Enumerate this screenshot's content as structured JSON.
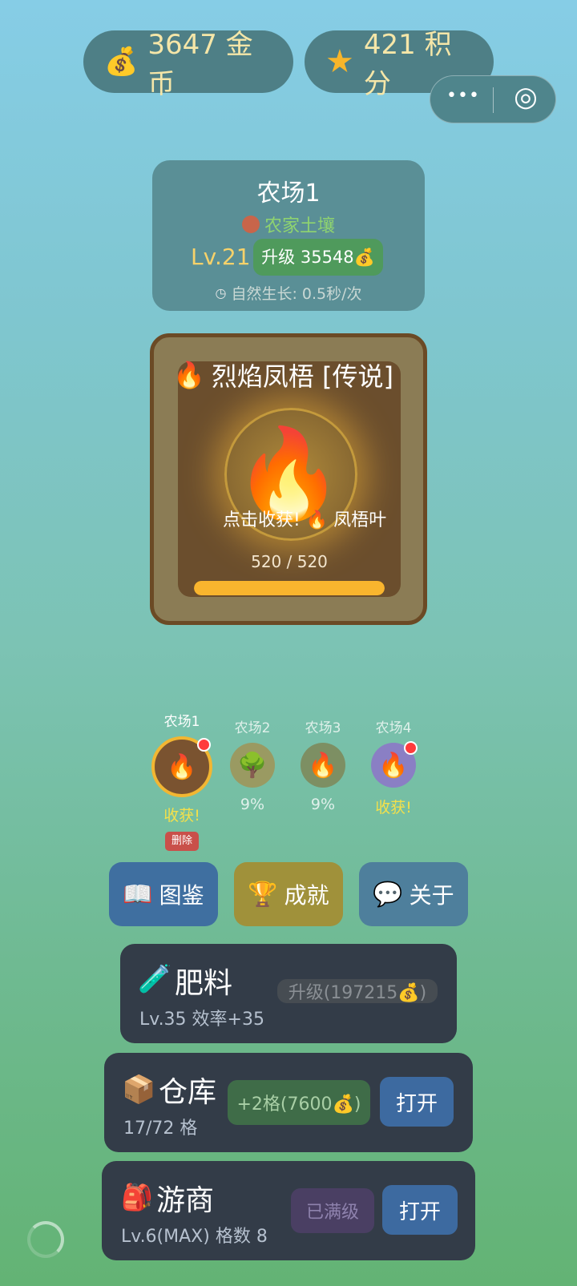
{
  "top": {
    "coins": "3647 金币",
    "points": "421 积分",
    "coin_icon": "💰",
    "star_icon": "★"
  },
  "capsule": {
    "more_icon": "•••",
    "close_icon": "◎"
  },
  "farm_card": {
    "title": "农场1",
    "soil": "农家土壤",
    "level": "Lv.21",
    "upgrade": "升级 35548💰",
    "growth": "自然生长: 0.5秒/次"
  },
  "plant": {
    "name": "烈焰凤梧 [传说]",
    "harvest_text": "点击收获! 🔥 凤梧叶",
    "progress_text": "520 / 520",
    "progress": 1.0
  },
  "farms": [
    {
      "label": "农场1",
      "icon": "🔥",
      "status": "收获!",
      "delete": "删除"
    },
    {
      "label": "农场2",
      "icon": "🌳",
      "status": "9%"
    },
    {
      "label": "农场3",
      "icon": "🔥",
      "status": "9%"
    },
    {
      "label": "农场4",
      "icon": "🔥",
      "status": "收获!"
    }
  ],
  "nav": {
    "encyclopedia": "图鉴",
    "achievements": "成就",
    "about": "关于"
  },
  "fertilizer": {
    "title": "肥料",
    "sub": "Lv.35 效率+35",
    "upgrade": "升级(197215💰)"
  },
  "warehouse": {
    "title": "仓库",
    "sub": "17/72 格",
    "expand": "+2格(7600💰)",
    "open": "打开"
  },
  "merchant": {
    "title": "游商",
    "sub": "Lv.6(MAX)  格数 8",
    "maxed": "已满级",
    "open": "打开"
  }
}
